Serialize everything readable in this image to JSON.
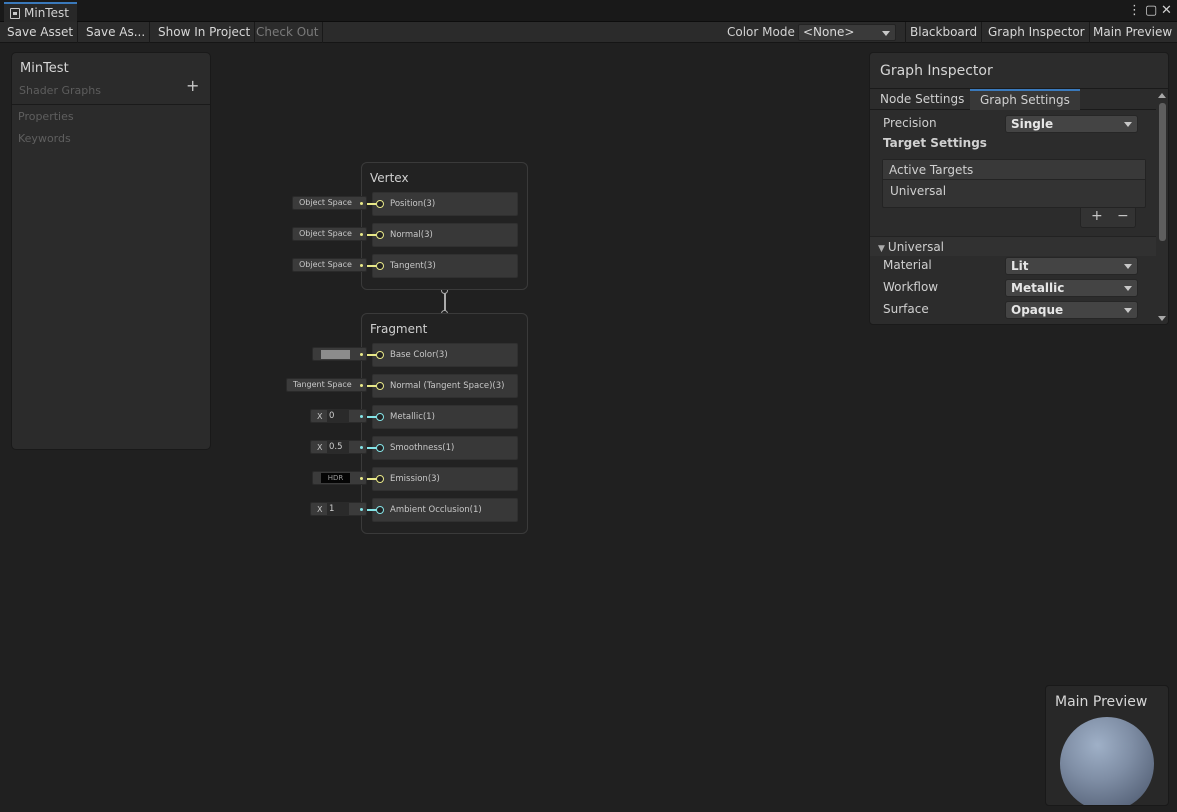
{
  "window": {
    "tab_title": "MinTest",
    "menu_icon": "kebab-icon",
    "maximize_icon": "maximize-icon",
    "close_icon": "close-icon"
  },
  "toolbar": {
    "save_asset": "Save Asset",
    "save_as": "Save As...",
    "show_in_project": "Show In Project",
    "check_out": "Check Out",
    "color_mode_label": "Color Mode",
    "color_mode_value": "<None>",
    "blackboard": "Blackboard",
    "graph_inspector": "Graph Inspector",
    "main_preview": "Main Preview"
  },
  "blackboard": {
    "title": "MinTest",
    "subtitle": "Shader Graphs",
    "add": "+",
    "sections": [
      "Properties",
      "Keywords"
    ]
  },
  "vertex": {
    "title": "Vertex",
    "slots": [
      {
        "label": "Position(3)",
        "input": "Object Space"
      },
      {
        "label": "Normal(3)",
        "input": "Object Space"
      },
      {
        "label": "Tangent(3)",
        "input": "Object Space"
      }
    ]
  },
  "fragment": {
    "title": "Fragment",
    "slots": [
      {
        "label": "Base Color(3)",
        "input_color": "#8c8c8c"
      },
      {
        "label": "Normal (Tangent Space)(3)",
        "input": "Tangent Space"
      },
      {
        "label": "Metallic(1)",
        "axis": "X",
        "value": "0"
      },
      {
        "label": "Smoothness(1)",
        "axis": "X",
        "value": "0.5"
      },
      {
        "label": "Emission(3)",
        "input": "HDR"
      },
      {
        "label": "Ambient Occlusion(1)",
        "axis": "X",
        "value": "1"
      }
    ]
  },
  "inspector": {
    "title": "Graph Inspector",
    "tabs": [
      "Node Settings",
      "Graph Settings"
    ],
    "active_tab": "Graph Settings",
    "precision_label": "Precision",
    "precision_value": "Single",
    "target_settings": "Target Settings",
    "active_targets": "Active Targets",
    "targets": [
      "Universal"
    ],
    "add": "+",
    "remove": "−",
    "section": "Universal",
    "material_label": "Material",
    "material_value": "Lit",
    "workflow_label": "Workflow",
    "workflow_value": "Metallic",
    "surface_label": "Surface",
    "surface_value": "Opaque"
  },
  "preview": {
    "title": "Main Preview"
  },
  "colors": {
    "accent": "#3a79bb",
    "vector_port": "#e8e888",
    "float_port": "#84e4e7"
  }
}
